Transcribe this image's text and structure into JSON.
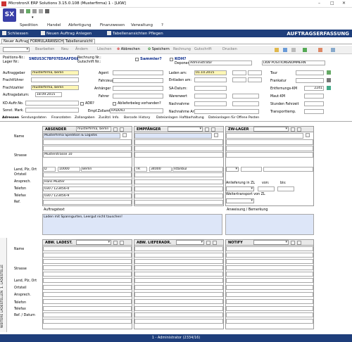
{
  "window": {
    "title": "MicrotronX ERP Solutions 3.15.0.108 (Musterfirma) 1 - [LKW]",
    "min": "–",
    "max": "□",
    "close": "✕"
  },
  "logo": "SX",
  "menu": [
    "Spedition",
    "Handel",
    "Abfertigung",
    "Finanzwesen",
    "Verwaltung",
    "?"
  ],
  "toolbar": {
    "close": "Schliessen",
    "new": "Neuen Auftrag Anlegen",
    "views": "Tabellenansichten Pflegen",
    "title": "AUFTRAGSERFASSUNG"
  },
  "tabs_top": [
    "Neuer Auftrag",
    "FORMULARANSICHT",
    "Tabellenansicht"
  ],
  "actions": {
    "bearbeiten": "Bearbeiten",
    "neu": "Neu",
    "aendern": "Ändern",
    "loeschen": "Löschen",
    "abbrechen": "Abbrechen",
    "speichern": "Speichern",
    "rechnung": "Rechnung",
    "gutschrift": "Gutschrift",
    "drucken": "Drucken"
  },
  "pos": {
    "positions_label": "Positions-Nr.:",
    "lager_label": "Lager Nr.:",
    "positions_value": "SNEUS3C7BF07EDAAFD6$",
    "rechnung_label": "Rechnung Nr.:",
    "gutschrift_label": "Gutschrift Nr.:",
    "sammler": "Sammler?",
    "koh": "KOH?",
    "deponent_label": "Deponent:",
    "deponent_value": "Administrator",
    "view_select": "LKW POSITIONSNUMMERN"
  },
  "left": {
    "auftraggeber_label": "Auftraggeber",
    "auftraggeber": "musterfirma, berlin",
    "frachtfuehrer_label": "Frachtführer",
    "frachtzahler_label": "Frachtzahler",
    "frachtzahler": "musterfirma, berlin",
    "auftragsdatum_label": "Auftragsdatum:",
    "auftragsdatum": "18.09.2015",
    "kd_label": "KD-Auftr.No.",
    "sonst_label": "Sonst. Mark."
  },
  "mid": {
    "agent": "Agent",
    "fahrzeug": "Fahrzeug",
    "anhaenger": "Anhänger",
    "fahrer": "Fahrer",
    "adr": "ADR?",
    "ablieferbeleg": "Ablieferbeleg vorhanden?",
    "empf_label": "Empf.Zollamt",
    "empf_value": "HALKALI"
  },
  "right": {
    "laden": "Laden am:",
    "laden_value": "01.10.2015",
    "entladen": "Entladen am:",
    "sa": "SA-Datum:",
    "warenwert": "Warenwert",
    "nachnahme": "Nachnahme",
    "nachnahme_art": "Nachnahme Art",
    "tour": "Tour",
    "frankatur": "Frankatur",
    "entfernungs": "Entfernungs-KM",
    "entfernungs_value": "2241",
    "maut": "Maut-KM",
    "stunden": "Stunden Fahrzeit",
    "transport": "Transporttemp."
  },
  "tabs_bottom": [
    "Adressen",
    "Sendungsdaten",
    "Finanzdaten",
    "Zollangaben",
    "Zusätzl. Info.",
    "Barcode",
    "History",
    "Dateianlagen",
    "Haftbarhaltung",
    "Dateianlagen für Offene Posten"
  ],
  "addr": {
    "absender": "ABSENDER",
    "absender_sel": "musterfirma, berlin",
    "empfaenger": "EMPFÄNGER",
    "zw_lager": "ZW-LAGER",
    "name": "Name",
    "strasse": "Strasse",
    "lpo": "Land, Plz, Ort",
    "ortsteil": "Ortsteil",
    "ansprech": "Ansprech.",
    "telefon": "Telefon",
    "telefax": "Telefax",
    "ref": "Ref.",
    "abs_name": "Musterfirma Spedition & Logistik",
    "abs_str": "Musterstrasse 10",
    "abs_land": "D",
    "abs_plz": "10000",
    "abs_ort": "Berlin",
    "abs_ansp": "Hans Muster",
    "abs_tel": "030 / 123456-0",
    "abs_fax": "030 / 123456-9",
    "emp_land": "TR",
    "emp_plz": "34000",
    "emp_ort": "Istanbul",
    "anlief": "Anlieferung in ZL",
    "von": "von:",
    "bis": "bis:",
    "weiter": "Weitertransport von ZL",
    "auftragstext": "Auftragstext",
    "auftragstext_value": "Laden mit Spanngurten, Leergut nicht tauschen!",
    "anweisung": "Anweisung / Bemerkung",
    "abw_ladest": "ABW. LADEST.",
    "abw_liefer": "ABW. LIEFERADR.",
    "notify": "NOTIFY",
    "ref_datum": "Ref. / Datum",
    "vtab1": "1. LADESTELLE",
    "vtab2": "WEITERE LADESTELLEN"
  },
  "status": "1 - Administrator (2334/16)"
}
